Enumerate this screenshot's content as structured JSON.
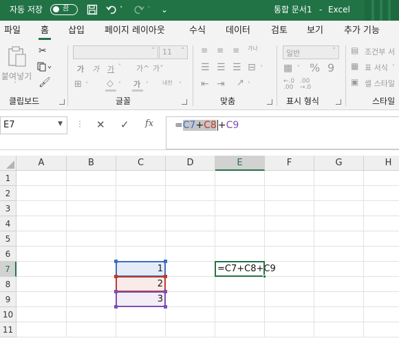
{
  "title_bar": {
    "autosave_label": "자동 저장",
    "autosave_toggle": "끔",
    "document_title": "통합 문서1",
    "separator": "-",
    "app_name": "Excel"
  },
  "tabs": [
    "파일",
    "홈",
    "삽입",
    "페이지 레이아웃",
    "수식",
    "데이터",
    "검토",
    "보기",
    "추가 기능"
  ],
  "active_tab": "홈",
  "ribbon": {
    "clipboard": {
      "group_label": "클립보드",
      "paste_label": "붙여넣기"
    },
    "font": {
      "group_label": "글꼴",
      "font_size": "11",
      "bold": "가",
      "italic": "가",
      "underline": "가",
      "grow": "가^",
      "shrink": "가˅",
      "font_color": "가",
      "phonetic": "내천"
    },
    "alignment": {
      "group_label": "맞춤",
      "wrap": "가나"
    },
    "number": {
      "group_label": "표시 형식",
      "format": "일반",
      "percent": "%",
      "comma": "9"
    },
    "styles": {
      "group_label": "스타일",
      "conditional": "조건부 서",
      "as_table": "표 서식",
      "cell_styles": "셀 스타일"
    }
  },
  "formula_bar": {
    "name_box": "E7",
    "fx": "fx",
    "formula_prefix": "=",
    "ref1": "C7",
    "op1": "+",
    "ref2": "C8",
    "op2": "+",
    "ref3": "C9"
  },
  "colors": {
    "accent": "#217346",
    "ref1": "#3c6dc5",
    "ref2": "#c0392b",
    "ref3": "#7d4fb0"
  },
  "sheet": {
    "columns": [
      "A",
      "B",
      "C",
      "D",
      "E",
      "F",
      "G",
      "H"
    ],
    "rows": [
      "1",
      "2",
      "3",
      "4",
      "5",
      "6",
      "7",
      "8",
      "9",
      "10",
      "11"
    ],
    "selected_cell": "E7",
    "cells": {
      "C7": "1",
      "C8": "2",
      "C9": "3",
      "E7": "=C7+C8+C9"
    }
  }
}
